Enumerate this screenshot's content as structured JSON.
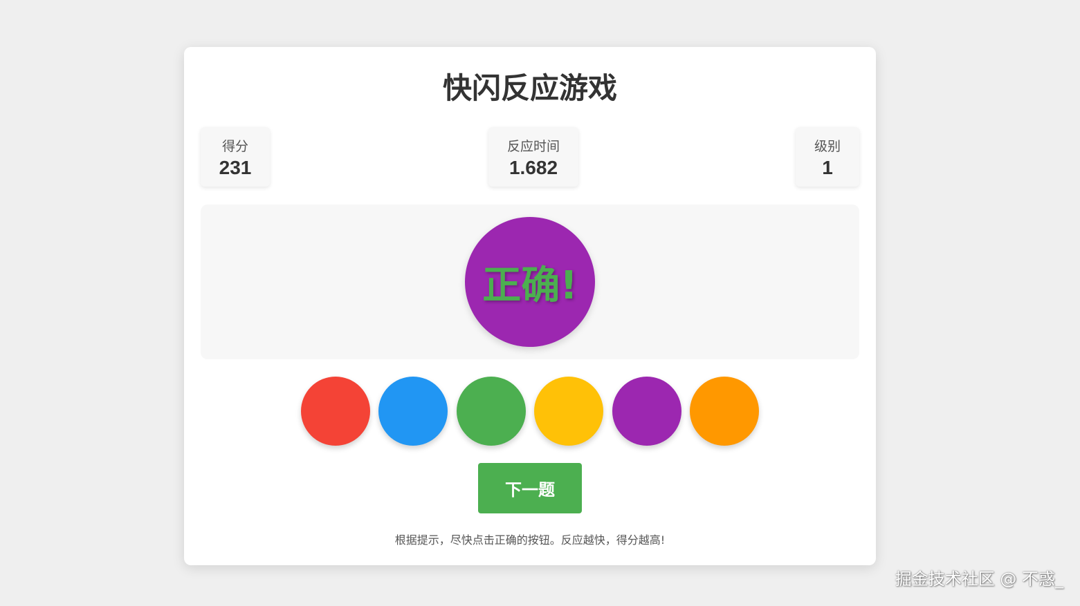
{
  "game": {
    "title": "快闪反应游戏",
    "stats": {
      "score": {
        "label": "得分",
        "value": "231"
      },
      "reaction_time": {
        "label": "反应时间",
        "value": "1.682"
      },
      "level": {
        "label": "级别",
        "value": "1"
      }
    },
    "target": {
      "color": "#9c27b0",
      "feedback_text": "正确!",
      "feedback_color": "#4caf50"
    },
    "options": [
      {
        "name": "red",
        "color": "#f44336"
      },
      {
        "name": "blue",
        "color": "#2196f3"
      },
      {
        "name": "green",
        "color": "#4caf50"
      },
      {
        "name": "yellow",
        "color": "#ffc107"
      },
      {
        "name": "purple",
        "color": "#9c27b0"
      },
      {
        "name": "orange",
        "color": "#ff9800"
      }
    ],
    "next_button": {
      "label": "下一题",
      "color": "#4caf50"
    },
    "hint": "根据提示，尽快点击正确的按钮。反应越快，得分越高!"
  },
  "watermark": "掘金技术社区 @ 不惑_"
}
